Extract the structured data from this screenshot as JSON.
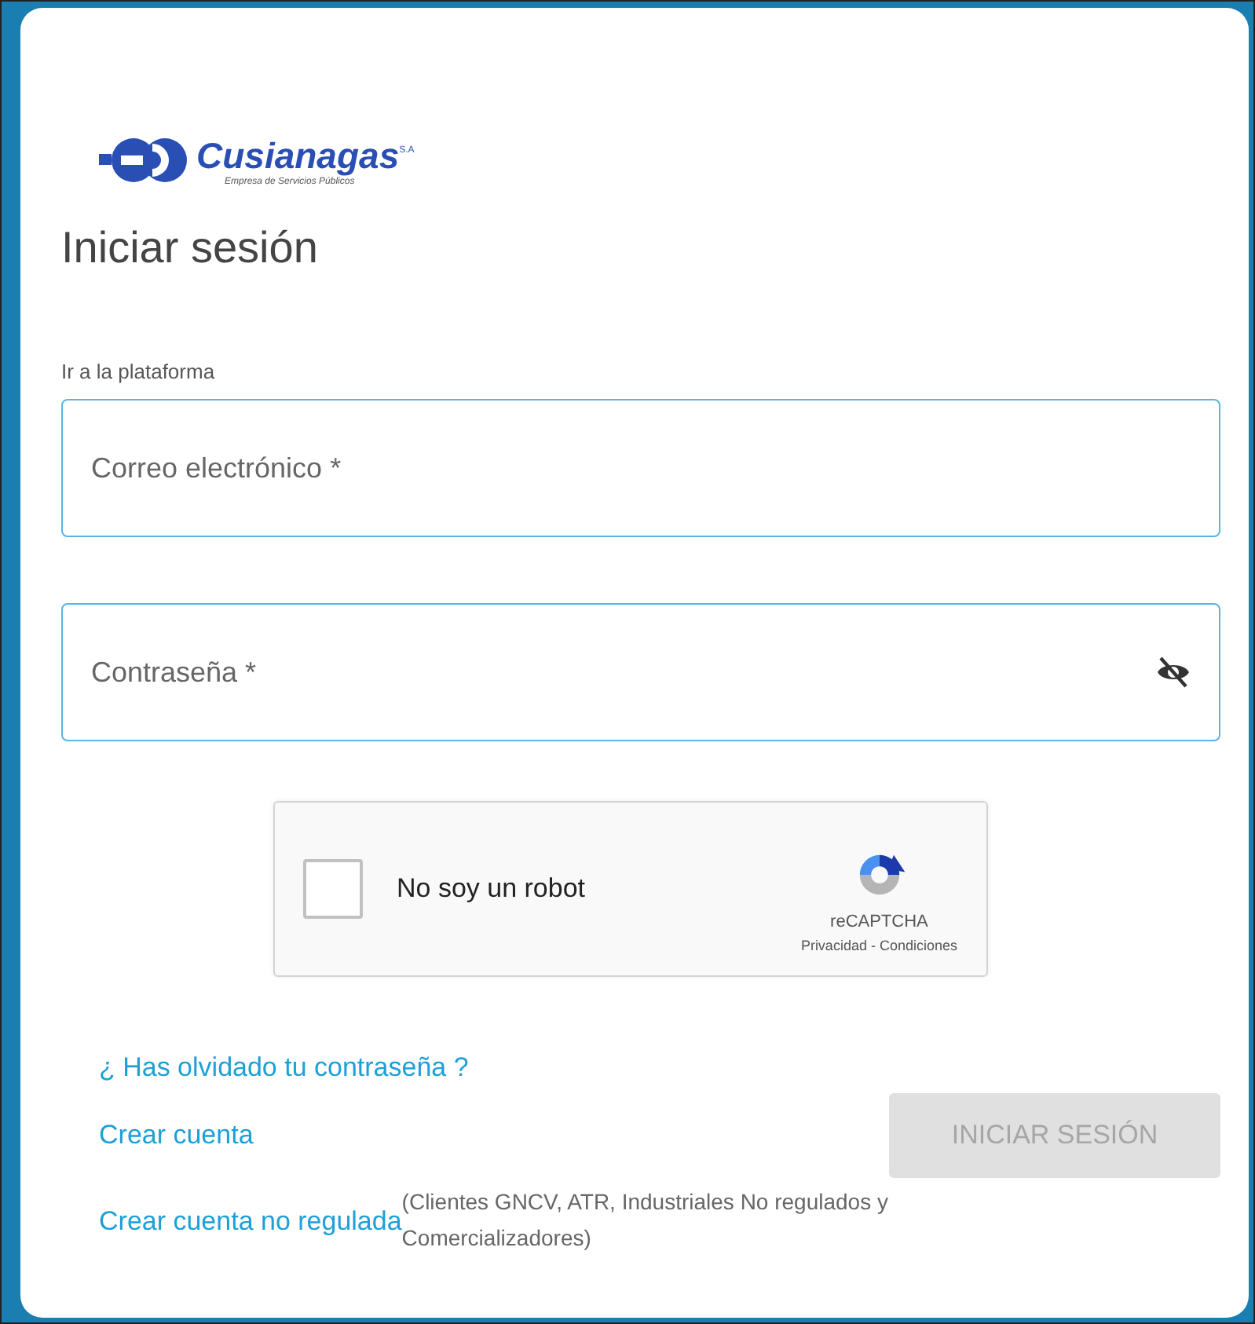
{
  "logo": {
    "name": "Cusianagas",
    "suffix": "S.A",
    "tagline": "Empresa de Servicios Públicos"
  },
  "title": "Iniciar sesión",
  "section_label": "Ir a la plataforma",
  "fields": [
    {
      "placeholder": "Correo electrónico *",
      "kind": "text"
    },
    {
      "placeholder": "Contraseña *",
      "kind": "password"
    }
  ],
  "captcha": {
    "label": "No soy un robot",
    "checked": false,
    "brand": "reCAPTCHA",
    "links": "Privacidad - Condiciones"
  },
  "forgot_link": "¿ Has olvidado tu contraseña ?",
  "create_link": "Crear cuenta",
  "login_button": {
    "label": "INICIAR SESIÓN",
    "disabled": true
  },
  "unregulated_link": "Crear cuenta no regulada",
  "unregulated_note": "(Clientes GNCV, ATR, Industriales No regulados y Comercializadores)"
}
